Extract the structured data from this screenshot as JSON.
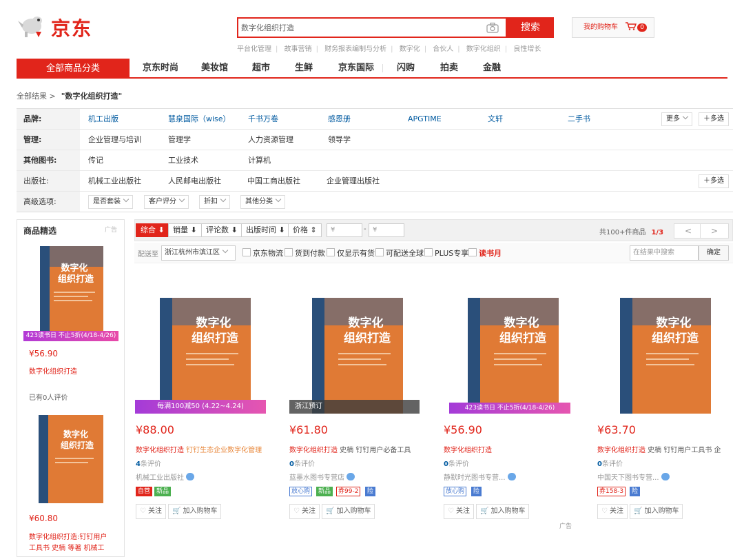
{
  "header": {
    "logo_text": "京东",
    "search_value": "数字化组织打造",
    "search_button": "搜索",
    "hotwords": [
      "平台化管理",
      "故事营销",
      "财务报表编制与分析",
      "数字化",
      "合伙人",
      "数字化组织",
      "良性增长"
    ],
    "cart_label": "我的购物车",
    "cart_count": "0"
  },
  "nav": {
    "all_categories": "全部商品分类",
    "items": [
      "京东时尚",
      "美妆馆",
      "超市",
      "生鲜",
      "京东国际",
      "闪购",
      "拍卖",
      "金融"
    ]
  },
  "breadcrumb": {
    "root": "全部结果 >",
    "query": "\"数字化组织打造\""
  },
  "filters": {
    "brand": {
      "label": "品牌:",
      "values": [
        "机工出版",
        "慧泉国际（wise）",
        "千书万卷",
        "感恩册",
        "APGTIME",
        "文轩",
        "二手书"
      ],
      "more": "更多",
      "multi": "多选"
    },
    "management": {
      "label": "管理:",
      "values": [
        "企业管理与培训",
        "管理学",
        "人力资源管理",
        "领导学"
      ]
    },
    "other_books": {
      "label": "其他图书:",
      "values": [
        "传记",
        "工业技术",
        "计算机"
      ]
    },
    "publisher": {
      "label": "出版社:",
      "values": [
        "机械工业出版社",
        "人民邮电出版社",
        "中国工商出版社",
        "企业管理出版社"
      ],
      "multi": "多选"
    },
    "advanced": {
      "label": "高级选项:",
      "values": [
        "是否套装",
        "客户评分",
        "折扣",
        "其他分类"
      ]
    }
  },
  "rail": {
    "title": "商品精选",
    "ad": "广告",
    "promo": "423读书日  不止5折(4/18-4/26)",
    "item1": {
      "price": "¥56.90",
      "name": "数字化组织打造",
      "reviews": "已有0人评价"
    },
    "item2": {
      "price": "¥60.80",
      "name_line1": "数字化组织打造:钉钉用户",
      "name_line2": "工具书 史楠 等著 机械工"
    }
  },
  "sort": {
    "buttons": [
      "综合",
      "销量",
      "评论数",
      "出版时间",
      "价格"
    ],
    "price_from": "¥",
    "price_to": "¥",
    "dash": "-",
    "count": "共100+件商品",
    "page": "1/3",
    "prev": "<",
    "next": ">"
  },
  "delivery": {
    "label": "配送至",
    "address": "浙江杭州市滨江区",
    "options": [
      "京东物流",
      "货到付款",
      "仅显示有货",
      "可配送全球",
      "PLUS专享",
      "读书月"
    ],
    "search_placeholder": "在结果中搜索",
    "confirm": "确定"
  },
  "products": [
    {
      "banner": "每满100减50 (4.22~4.24)",
      "price": "¥88.00",
      "name": "数字化组织打造",
      "name_sub": " 钉钉生态企业数字化管理",
      "reviews_num": "4",
      "reviews_suffix": "条评价",
      "shop": "机械工业出版社",
      "tags": [
        "自营",
        "新品"
      ],
      "follow": "关注",
      "add_cart": "加入购物车"
    },
    {
      "banner": "浙江预订",
      "price": "¥61.80",
      "name": "数字化组织打造",
      "name_sub": " 史楠 钉钉用户必备工具",
      "reviews_num": "0",
      "reviews_suffix": "条评价",
      "shop": "蓝墨水图书专营店",
      "tags": [
        "放心购",
        "新品",
        "券99-2",
        "险"
      ],
      "follow": "关注",
      "add_cart": "加入购物车"
    },
    {
      "banner": "423读书日  不止5折(4/18-4/26)",
      "price": "¥56.90",
      "name": "数字化组织打造",
      "name_sub": "",
      "reviews_num": "0",
      "reviews_suffix": "条评价",
      "shop": "静默时光图书专营...",
      "tags": [
        "放心购",
        "险"
      ],
      "follow": "关注",
      "add_cart": "加入购物车"
    },
    {
      "banner": "",
      "price": "¥63.70",
      "name": "数字化组织打造",
      "name_sub": " 史楠 钉钉用户工具书 企",
      "reviews_num": "0",
      "reviews_suffix": "条评价",
      "shop": "中国天下图书专营...",
      "tags": [
        "券158-3",
        "险"
      ],
      "follow": "关注",
      "add_cart": "加入购物车"
    }
  ],
  "ad_label": "广告",
  "book": {
    "title_line1": "数字化",
    "title_line2": "组织打造"
  },
  "colors": {
    "brand": "#e1251b",
    "book_orange": "#e07a35",
    "book_blue": "#2a4f7a"
  }
}
